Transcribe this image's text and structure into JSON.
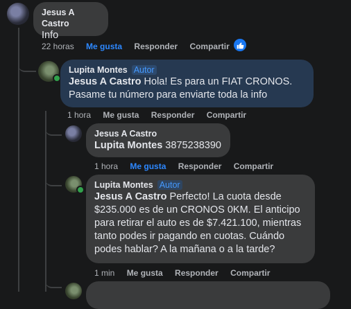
{
  "comments": [
    {
      "author": "Jesus A Castro",
      "badge": "",
      "text": "Info",
      "time": "22 horas",
      "like": "Me gusta",
      "reply": "Responder",
      "share": "Compartir"
    },
    {
      "author": "Lupita Montes",
      "badge": "Autor",
      "mention": "Jesus A Castro",
      "text_line1": " Hola! Es para un FIAT CRONOS.",
      "text_line2": "Pasame tu número para enviarte toda la info",
      "time": "1 hora",
      "like": "Me gusta",
      "reply": "Responder",
      "share": "Compartir"
    },
    {
      "author": "Jesus A Castro",
      "badge": "",
      "mention": "Lupita Montes",
      "text": " 3875238390",
      "time": "1 hora",
      "like": "Me gusta",
      "reply": "Responder",
      "share": "Compartir"
    },
    {
      "author": "Lupita Montes",
      "badge": "Autor",
      "mention": "Jesus A Castro",
      "text_line1": " Perfecto! La cuota desde",
      "text_line2": "$235.000 es de un CRONOS 0KM. El anticipo",
      "text_line3": "para retirar el auto es de $7.421.100, mientras",
      "text_line4": "tanto podes ir pagando en cuotas. Cuándo",
      "text_line5": "podes hablar? A la mañana o a la tarde?",
      "time": "1 min",
      "like": "Me gusta",
      "reply": "Responder",
      "share": "Compartir"
    }
  ],
  "colors": {
    "background": "#18191a",
    "bubble": "#3a3b3c",
    "author_bubble": "#263951",
    "link_blue": "#2d88ff",
    "badge_blue": "#4599ff",
    "online_green": "#31a24c"
  }
}
